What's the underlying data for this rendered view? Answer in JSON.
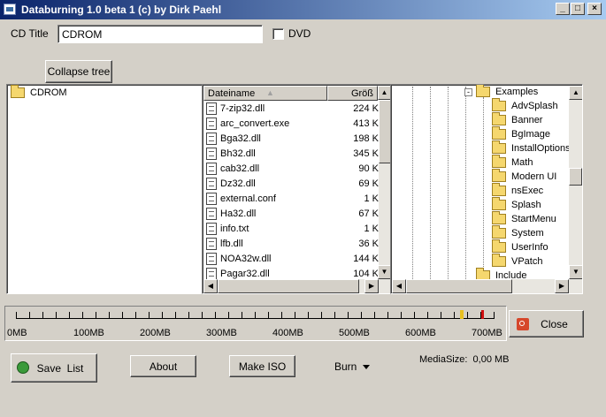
{
  "window": {
    "title": "Databurning 1.0 beta 1 (c) by Dirk Paehl"
  },
  "form": {
    "cd_title_label": "CD Title",
    "cd_title_value": "CDROM",
    "dvd_label": "DVD"
  },
  "buttons": {
    "collapse_tree": "Collapse tree",
    "close": "Close",
    "save_list": "Save  List",
    "about": "About",
    "make_iso": "Make ISO",
    "burn": "Burn"
  },
  "left_tree": {
    "root": "CDROM"
  },
  "file_list": {
    "columns": [
      "Dateiname",
      "Größ"
    ],
    "rows": [
      {
        "name": "7-zip32.dll",
        "size": "224 K"
      },
      {
        "name": "arc_convert.exe",
        "size": "413 K"
      },
      {
        "name": "Bga32.dll",
        "size": "198 K"
      },
      {
        "name": "Bh32.dll",
        "size": "345 K"
      },
      {
        "name": "cab32.dll",
        "size": "90 K"
      },
      {
        "name": "Dz32.dll",
        "size": "69 K"
      },
      {
        "name": "external.conf",
        "size": "1 K"
      },
      {
        "name": "Ha32.dll",
        "size": "67 K"
      },
      {
        "name": "info.txt",
        "size": "1 K"
      },
      {
        "name": "lfb.dll",
        "size": "36 K"
      },
      {
        "name": "NOA32w.dll",
        "size": "144 K"
      },
      {
        "name": "Pagar32.dll",
        "size": "104 K"
      }
    ]
  },
  "folder_tree": {
    "items": [
      "Examples",
      "AdvSplash",
      "Banner",
      "BgImage",
      "InstallOptions",
      "Math",
      "Modern UI",
      "nsExec",
      "Splash",
      "StartMenu",
      "System",
      "UserInfo",
      "VPatch",
      "Include"
    ]
  },
  "ruler": {
    "labels": [
      "0MB",
      "100MB",
      "200MB",
      "300MB",
      "400MB",
      "500MB",
      "600MB",
      "700MB"
    ]
  },
  "status": {
    "media_size": "MediaSize:  0,00 MB"
  },
  "colors": {
    "title_start": "#0a246a",
    "title_end": "#a6caf0",
    "marker_yellow": "#e8c020",
    "marker_red": "#d01010"
  },
  "icons": [
    "app-icon",
    "folder-icon",
    "file-icon",
    "sort-arrow-icon",
    "close-stop-icon",
    "save-list-icon",
    "dropdown-arrow-icon"
  ]
}
